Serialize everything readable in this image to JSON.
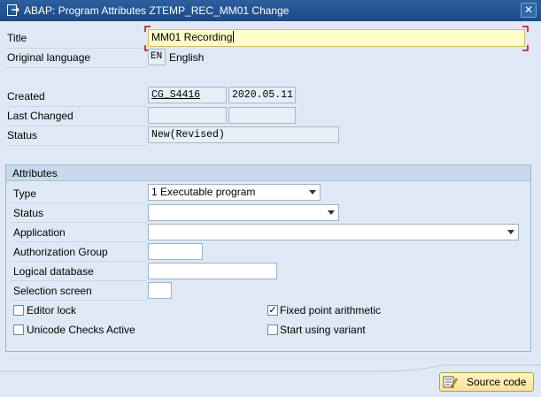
{
  "window": {
    "title": "ABAP: Program Attributes ZTEMP_REC_MM01 Change",
    "close_symbol": "✕"
  },
  "header": {
    "title_label": "Title",
    "title_value": "MM01 Recording",
    "lang_label": "Original language",
    "lang_code": "EN",
    "lang_name": "English",
    "created_label": "Created",
    "created_by": "CG_S4416",
    "created_date": "2020.05.11",
    "changed_label": "Last Changed",
    "changed_by": "",
    "changed_date": "",
    "status_label": "Status",
    "status_value": "New(Revised)"
  },
  "attributes": {
    "group_title": "Attributes",
    "type_label": "Type",
    "type_value": "1 Executable program",
    "status_label": "Status",
    "status_value": "",
    "application_label": "Application",
    "application_value": "",
    "auth_label": "Authorization Group",
    "auth_value": "",
    "ldb_label": "Logical database",
    "ldb_value": "",
    "selscreen_label": "Selection screen",
    "selscreen_value": "",
    "editor_lock_label": "Editor lock",
    "editor_lock_checked": false,
    "unicode_label": "Unicode Checks Active",
    "unicode_checked": false,
    "fixed_point_label": "Fixed point arithmetic",
    "fixed_point_checked": true,
    "variant_label": "Start using variant",
    "variant_checked": false,
    "check_mark": "✓"
  },
  "footer": {
    "source_code_label": "Source code"
  }
}
